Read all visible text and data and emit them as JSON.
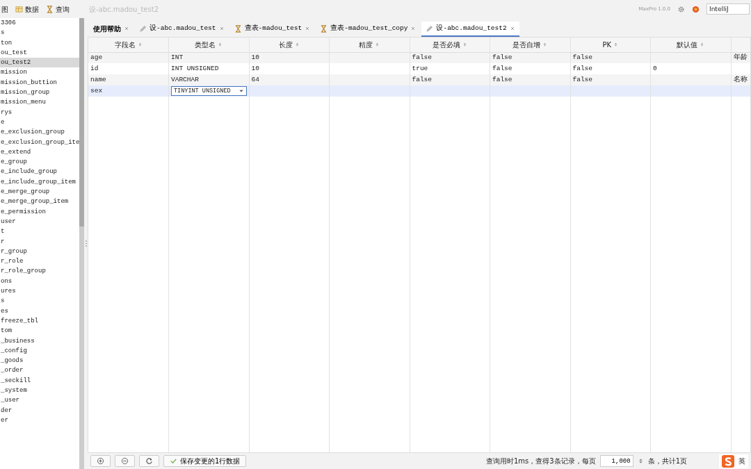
{
  "toolbar": {
    "items": [
      {
        "label": "图",
        "kind": "cut"
      },
      {
        "label": "数据",
        "kind": "data"
      },
      {
        "label": "查询",
        "kind": "query"
      }
    ],
    "title": "设-abc.madou_test2",
    "version": "MaxPro 1.0.0",
    "theme_field": "IntelliJ"
  },
  "sidebar": {
    "items": [
      {
        "label": "3306",
        "selected": false
      },
      {
        "label": "s",
        "selected": false
      },
      {
        "label": "ton",
        "selected": false
      },
      {
        "label": "ou_test",
        "selected": false
      },
      {
        "label": "ou_test2",
        "selected": true
      },
      {
        "label": "mission",
        "selected": false
      },
      {
        "label": "mission_buttion",
        "selected": false
      },
      {
        "label": "mission_group",
        "selected": false
      },
      {
        "label": "mission_menu",
        "selected": false
      },
      {
        "label": "rys",
        "selected": false
      },
      {
        "label": "e",
        "selected": false
      },
      {
        "label": "e_exclusion_group",
        "selected": false
      },
      {
        "label": "e_exclusion_group_ite",
        "selected": false
      },
      {
        "label": "e_extend",
        "selected": false
      },
      {
        "label": "e_group",
        "selected": false
      },
      {
        "label": "e_include_group",
        "selected": false
      },
      {
        "label": "e_include_group_item",
        "selected": false
      },
      {
        "label": "e_merge_group",
        "selected": false
      },
      {
        "label": "e_merge_group_item",
        "selected": false
      },
      {
        "label": "e_permission",
        "selected": false
      },
      {
        "label": "user",
        "selected": false
      },
      {
        "label": "t",
        "selected": false
      },
      {
        "label": "r",
        "selected": false
      },
      {
        "label": "r_group",
        "selected": false
      },
      {
        "label": "r_role",
        "selected": false
      },
      {
        "label": "r_role_group",
        "selected": false
      },
      {
        "label": "ons",
        "selected": false
      },
      {
        "label": "ures",
        "selected": false
      },
      {
        "label": "s",
        "selected": false
      },
      {
        "label": "es",
        "selected": false
      },
      {
        "label": "freeze_tbl",
        "selected": false
      },
      {
        "label": "tom",
        "selected": false
      },
      {
        "label": "_business",
        "selected": false
      },
      {
        "label": "_config",
        "selected": false
      },
      {
        "label": "_goods",
        "selected": false
      },
      {
        "label": "_order",
        "selected": false
      },
      {
        "label": "_seckill",
        "selected": false
      },
      {
        "label": "_system",
        "selected": false
      },
      {
        "label": "_user",
        "selected": false
      },
      {
        "label": "der",
        "selected": false
      },
      {
        "label": "er",
        "selected": false
      }
    ]
  },
  "tabs": [
    {
      "label": "使用帮助",
      "kind": "help",
      "selected": false
    },
    {
      "label": "设-abc.madou_test",
      "kind": "design",
      "selected": false
    },
    {
      "label": "查表-madou_test",
      "kind": "query",
      "selected": false
    },
    {
      "label": "查表-madou_test_copy",
      "kind": "query",
      "selected": false
    },
    {
      "label": "设-abc.madou_test2",
      "kind": "design",
      "selected": true
    }
  ],
  "table": {
    "columns": [
      "字段名",
      "类型名",
      "长度",
      "精度",
      "是否必填",
      "是否自增",
      "PK",
      "默认值"
    ],
    "rows": [
      {
        "cells": [
          "age",
          "INT",
          "10",
          "",
          "false",
          "false",
          "false",
          "",
          "年龄"
        ],
        "selected": false,
        "editing": false
      },
      {
        "cells": [
          "id",
          "INT UNSIGNED",
          "10",
          "",
          "true",
          "false",
          "false",
          "0",
          ""
        ],
        "selected": false,
        "editing": false
      },
      {
        "cells": [
          "name",
          "VARCHAR",
          "64",
          "",
          "false",
          "false",
          "false",
          "",
          "名称"
        ],
        "selected": false,
        "editing": false
      },
      {
        "cells": [
          "sex",
          "TINYINT UNSIGNED",
          "",
          "",
          "",
          "",
          "",
          "",
          ""
        ],
        "selected": true,
        "editing": true
      }
    ]
  },
  "status_bar": {
    "save_button": "保存变更的1行数据",
    "query_info": "查询用时1ms，查得3条记录，每页",
    "page_size": "1,000",
    "page_info": "条，共计1页"
  },
  "ime": {
    "label": "英"
  }
}
